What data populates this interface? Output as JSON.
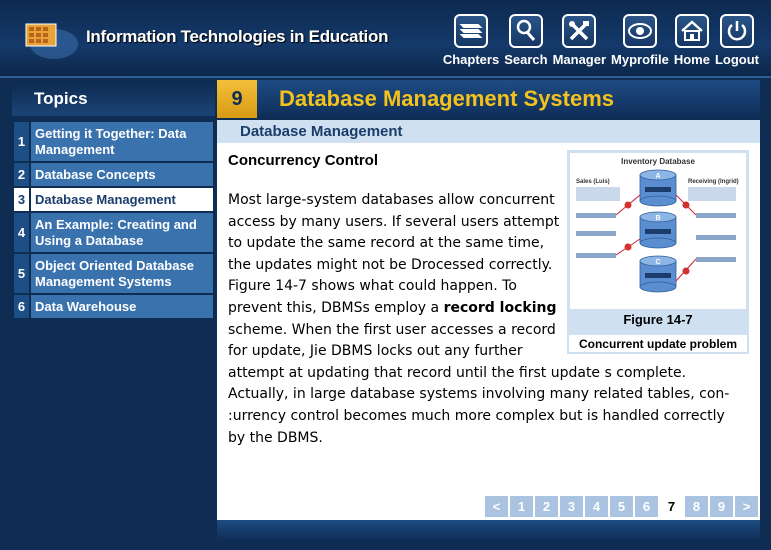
{
  "header": {
    "title": "Information Technologies in Education",
    "nav": [
      {
        "label": "Chapters",
        "icon": "chapters-icon"
      },
      {
        "label": "Search",
        "icon": "search-icon"
      },
      {
        "label": "Manager",
        "icon": "tools-icon"
      },
      {
        "label": "Myprofile",
        "icon": "eye-icon"
      },
      {
        "label": "Home",
        "icon": "home-icon"
      },
      {
        "label": "Logout",
        "icon": "power-icon"
      }
    ]
  },
  "sidebar": {
    "title": "Topics",
    "items": [
      {
        "num": "1",
        "label": "Getting it Together: Data Management"
      },
      {
        "num": "2",
        "label": "Database Concepts"
      },
      {
        "num": "3",
        "label": "Database Management"
      },
      {
        "num": "4",
        "label": "An Example: Creating and Using a Database"
      },
      {
        "num": "5",
        "label": "Object Oriented Database Management Systems"
      },
      {
        "num": "6",
        "label": "Data Warehouse"
      }
    ],
    "active_index": 2
  },
  "chapter": {
    "number": "9",
    "title": "Database Management Systems"
  },
  "section": {
    "title": "Database Management",
    "subhead": "Concurrency Control"
  },
  "figure": {
    "image_title": "Inventory Database",
    "title": "Figure 14-7",
    "caption": "Concurrent update problem",
    "labels": {
      "a": "A",
      "b": "B",
      "c": "C",
      "left": "Sales (Luis)",
      "right": "Receiving (Ingrid)"
    }
  },
  "body": {
    "lines": [
      "Most large-system databases allow concurrent",
      "access by many users. If several users attempt",
      "to update the same record at the same time,",
      "the updates might not be Drocessed correctly.",
      "Figure 14-7 shows what could happen. To",
      "prevent this, DBMSs employ a ",
      "record locking",
      "scheme. When the first user accesses a record",
      "for update, Jie DBMS locks out any further",
      "attempt at updating that record until the first update s complete.",
      "Actually, in large database systems involving many related tables, con-",
      ":urrency control becomes much more complex but is handled correctly",
      "by the DBMS."
    ]
  },
  "pager": {
    "prev": "<",
    "next": ">",
    "pages": [
      "1",
      "2",
      "3",
      "4",
      "5",
      "6",
      "7",
      "8",
      "9"
    ],
    "current": "7"
  },
  "colors": {
    "background": "#0f2d52",
    "accent": "#f4c21d",
    "sidebar_item": "#3a72ad",
    "section_bar": "#cfe0f1"
  }
}
